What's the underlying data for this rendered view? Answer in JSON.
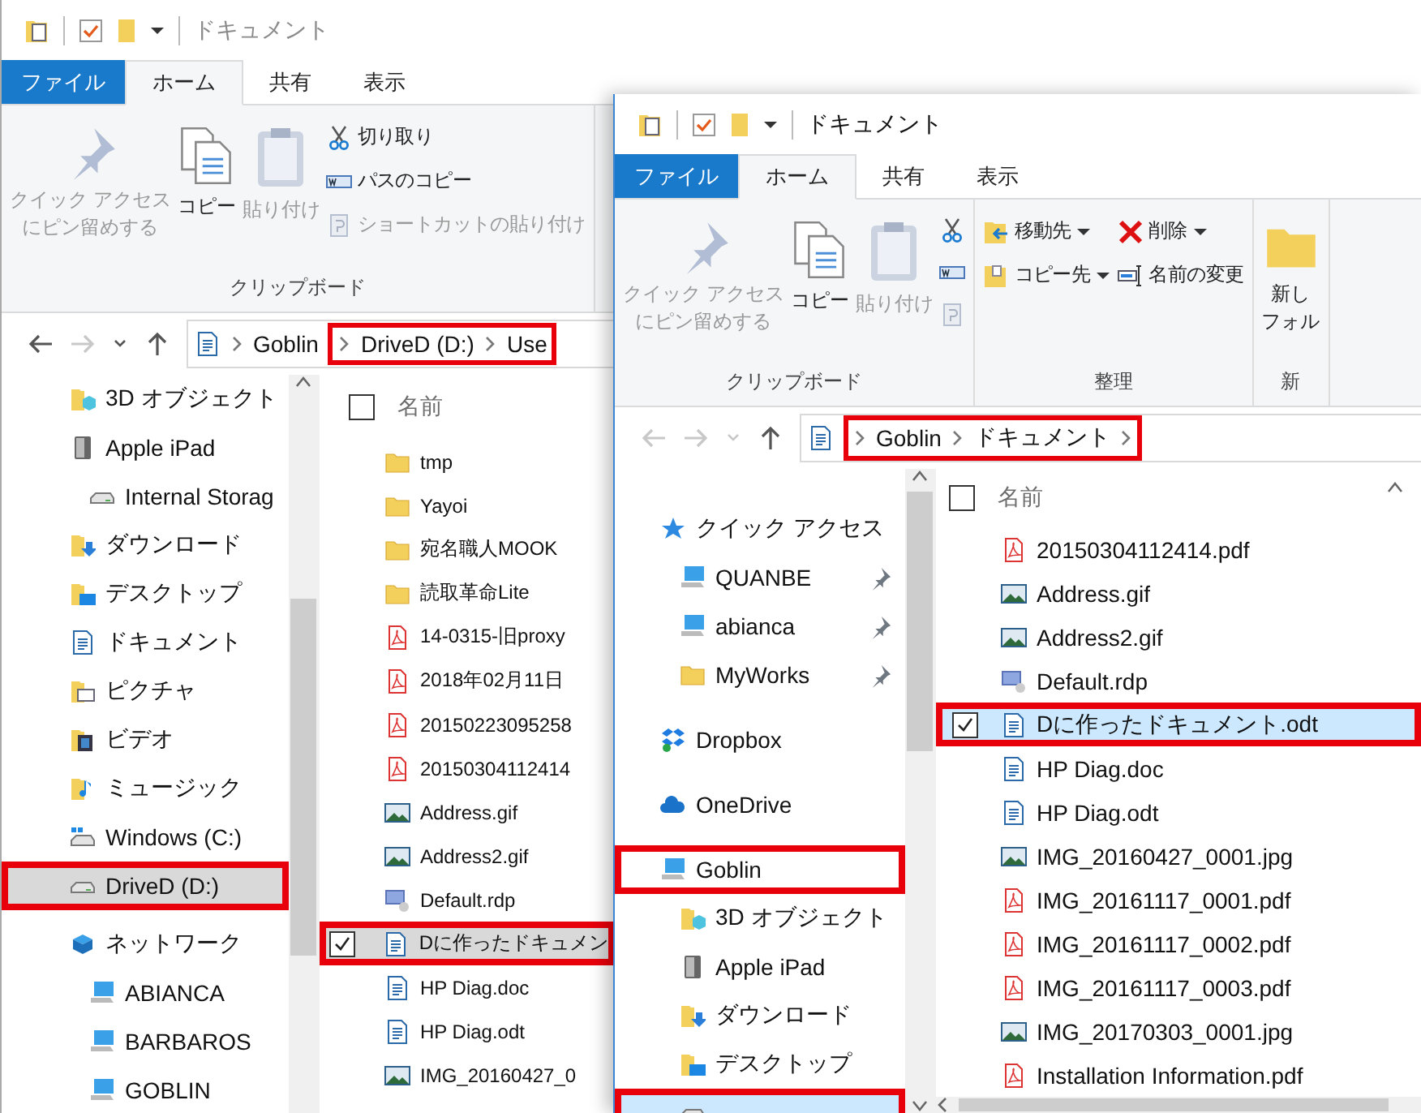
{
  "windows": [
    {
      "title": "ドキュメント",
      "active": false,
      "tabs": [
        {
          "label": "ファイル",
          "kind": "file",
          "selected": false
        },
        {
          "label": "ホーム",
          "kind": "tab",
          "selected": true
        },
        {
          "label": "共有",
          "kind": "tab",
          "selected": false
        },
        {
          "label": "表示",
          "kind": "tab",
          "selected": false
        }
      ],
      "ribbon_groups": [
        {
          "label": "クリップボード",
          "columns": [
            [
              {
                "kind": "pin",
                "lines": [
                  "クイック アクセス",
                  "にピン留めする"
                ],
                "disabled": true
              }
            ],
            [
              {
                "kind": "copy",
                "label": "コピー",
                "disabled": false
              }
            ],
            [
              {
                "kind": "paste",
                "label": "貼り付け",
                "disabled": true
              }
            ],
            [
              {
                "kind": "cut",
                "label": "切り取り",
                "disabled": false
              },
              {
                "kind": "copy_path",
                "label": "パスのコピー",
                "disabled": false
              },
              {
                "kind": "paste_shortcut",
                "label": "ショートカットの貼り付け",
                "disabled": true
              }
            ]
          ]
        }
      ],
      "address": {
        "crumbs": [
          {
            "label": "Goblin",
            "highlighted": false
          },
          {
            "label": "DriveD (D:)",
            "highlighted": true
          },
          {
            "label": "Use",
            "highlighted": true
          }
        ]
      },
      "nav_groups": [
        [
          {
            "label": "3D オブジェクト",
            "kind": "objects3d",
            "selected": false,
            "highlighted": false
          },
          {
            "label": "Apple iPad",
            "kind": "device",
            "selected": false,
            "highlighted": false,
            "children": [
              {
                "label": "Internal Storag",
                "kind": "drive",
                "selected": false,
                "highlighted": false
              }
            ]
          },
          {
            "label": "ダウンロード",
            "kind": "download",
            "selected": false,
            "highlighted": false
          },
          {
            "label": "デスクトップ",
            "kind": "desktop",
            "selected": false,
            "highlighted": false
          },
          {
            "label": "ドキュメント",
            "kind": "documents",
            "selected": false,
            "highlighted": false
          },
          {
            "label": "ピクチャ",
            "kind": "pictures",
            "selected": false,
            "highlighted": false
          },
          {
            "label": "ビデオ",
            "kind": "video",
            "selected": false,
            "highlighted": false
          },
          {
            "label": "ミュージック",
            "kind": "music",
            "selected": false,
            "highlighted": false
          },
          {
            "label": "Windows (C:)",
            "kind": "windrive",
            "selected": false,
            "highlighted": false
          },
          {
            "label": "DriveD (D:)",
            "kind": "drive",
            "selected": true,
            "highlighted": true
          }
        ],
        [
          {
            "label": "ネットワーク",
            "kind": "network",
            "selected": false,
            "highlighted": false,
            "children": [
              {
                "label": "ABIANCA",
                "kind": "computer",
                "selected": false,
                "highlighted": false
              },
              {
                "label": "BARBAROS",
                "kind": "computer",
                "selected": false,
                "highlighted": false
              },
              {
                "label": "GOBLIN",
                "kind": "computer",
                "selected": false,
                "highlighted": false
              }
            ]
          }
        ]
      ],
      "files": {
        "header": "名前",
        "rows": [
          {
            "name": "tmp",
            "kind": "folder",
            "selected": false,
            "highlighted": false
          },
          {
            "name": "Yayoi",
            "kind": "folder",
            "selected": false,
            "highlighted": false
          },
          {
            "name": "宛名職人MOOK",
            "kind": "folder",
            "selected": false,
            "highlighted": false
          },
          {
            "name": "読取革命Lite",
            "kind": "folder",
            "selected": false,
            "highlighted": false
          },
          {
            "name": "14-0315-旧proxy",
            "kind": "pdf",
            "selected": false,
            "highlighted": false
          },
          {
            "name": "2018年02月11日",
            "kind": "pdf",
            "selected": false,
            "highlighted": false
          },
          {
            "name": "20150223095258",
            "kind": "pdf",
            "selected": false,
            "highlighted": false
          },
          {
            "name": "20150304112414",
            "kind": "pdf",
            "selected": false,
            "highlighted": false
          },
          {
            "name": "Address.gif",
            "kind": "image",
            "selected": false,
            "highlighted": false
          },
          {
            "name": "Address2.gif",
            "kind": "image",
            "selected": false,
            "highlighted": false
          },
          {
            "name": "Default.rdp",
            "kind": "rdp",
            "selected": false,
            "highlighted": false
          },
          {
            "name": "Dに作ったドキュメン",
            "kind": "doc",
            "selected": true,
            "highlighted": true
          },
          {
            "name": "HP Diag.doc",
            "kind": "doc",
            "selected": false,
            "highlighted": false
          },
          {
            "name": "HP Diag.odt",
            "kind": "doc",
            "selected": false,
            "highlighted": false
          },
          {
            "name": "IMG_20160427_0",
            "kind": "image",
            "selected": false,
            "highlighted": false
          }
        ]
      }
    },
    {
      "title": "ドキュメント",
      "active": true,
      "tabs": [
        {
          "label": "ファイル",
          "kind": "file",
          "selected": false
        },
        {
          "label": "ホーム",
          "kind": "tab",
          "selected": true
        },
        {
          "label": "共有",
          "kind": "tab",
          "selected": false
        },
        {
          "label": "表示",
          "kind": "tab",
          "selected": false
        }
      ],
      "ribbon_groups": [
        {
          "label": "クリップボード",
          "columns": [
            [
              {
                "kind": "pin",
                "lines": [
                  "クイック アクセス",
                  "にピン留めする"
                ],
                "disabled": true
              }
            ],
            [
              {
                "kind": "copy",
                "label": "コピー",
                "disabled": false
              }
            ],
            [
              {
                "kind": "paste",
                "label": "貼り付け",
                "disabled": true
              }
            ],
            [
              {
                "kind": "cut",
                "disabled": false
              },
              {
                "kind": "copy_path",
                "disabled": false
              },
              {
                "kind": "paste_shortcut",
                "disabled": true
              }
            ]
          ]
        },
        {
          "label": "整理",
          "columns": [
            [
              {
                "kind": "move_to",
                "label": "移動先",
                "disabled": false,
                "dropdown": true
              },
              {
                "kind": "copy_to",
                "label": "コピー先",
                "disabled": false,
                "dropdown": true
              }
            ],
            [
              {
                "kind": "delete",
                "label": "削除",
                "disabled": false,
                "dropdown": true
              },
              {
                "kind": "rename",
                "label": "名前の変更",
                "disabled": false,
                "dropdown": false
              }
            ]
          ]
        },
        {
          "label": "新",
          "columns": [
            [
              {
                "kind": "new_folder",
                "lines": [
                  "新し",
                  "フォル"
                ],
                "disabled": false
              }
            ]
          ]
        }
      ],
      "address": {
        "crumbs": [
          {
            "label": "Goblin",
            "highlighted": true
          },
          {
            "label": "ドキュメント",
            "highlighted": true
          }
        ]
      },
      "nav_groups": [
        [
          {
            "label": "クイック アクセス",
            "kind": "star",
            "selected": false,
            "highlighted": false,
            "children": [
              {
                "label": "QUANBE",
                "kind": "computer",
                "selected": false,
                "highlighted": false,
                "pinned": true
              },
              {
                "label": "abianca",
                "kind": "computer",
                "selected": false,
                "highlighted": false,
                "pinned": true
              },
              {
                "label": "MyWorks",
                "kind": "folder",
                "selected": false,
                "highlighted": false,
                "pinned": true
              }
            ]
          }
        ],
        [
          {
            "label": "Dropbox",
            "kind": "dropbox",
            "selected": false,
            "highlighted": false
          }
        ],
        [
          {
            "label": "OneDrive",
            "kind": "cloud",
            "selected": false,
            "highlighted": false
          }
        ],
        [
          {
            "label": "Goblin",
            "kind": "computer",
            "selected": false,
            "highlighted": true,
            "children": [
              {
                "label": "3D オブジェクト",
                "kind": "objects3d",
                "selected": false,
                "highlighted": false
              },
              {
                "label": "Apple iPad",
                "kind": "device",
                "selected": false,
                "highlighted": false
              },
              {
                "label": "ダウンロード",
                "kind": "download",
                "selected": false,
                "highlighted": false
              },
              {
                "label": "デスクトップ",
                "kind": "desktop",
                "selected": false,
                "highlighted": false
              },
              {
                "kind": "drive",
                "selected": true,
                "highlighted": true
              }
            ]
          }
        ]
      ],
      "files": {
        "header": "名前",
        "rows": [
          {
            "name": "20150304112414.pdf",
            "kind": "pdf",
            "selected": false,
            "highlighted": false
          },
          {
            "name": "Address.gif",
            "kind": "image",
            "selected": false,
            "highlighted": false
          },
          {
            "name": "Address2.gif",
            "kind": "image",
            "selected": false,
            "highlighted": false
          },
          {
            "name": "Default.rdp",
            "kind": "rdp",
            "selected": false,
            "highlighted": false
          },
          {
            "name": "Dに作ったドキュメント.odt",
            "kind": "doc",
            "selected": true,
            "highlighted": true
          },
          {
            "name": "HP Diag.doc",
            "kind": "doc",
            "selected": false,
            "highlighted": false
          },
          {
            "name": "HP Diag.odt",
            "kind": "doc",
            "selected": false,
            "highlighted": false
          },
          {
            "name": "IMG_20160427_0001.jpg",
            "kind": "image",
            "selected": false,
            "highlighted": false
          },
          {
            "name": "IMG_20161117_0001.pdf",
            "kind": "pdf",
            "selected": false,
            "highlighted": false
          },
          {
            "name": "IMG_20161117_0002.pdf",
            "kind": "pdf",
            "selected": false,
            "highlighted": false
          },
          {
            "name": "IMG_20161117_0003.pdf",
            "kind": "pdf",
            "selected": false,
            "highlighted": false
          },
          {
            "name": "IMG_20170303_0001.jpg",
            "kind": "image",
            "selected": false,
            "highlighted": false
          },
          {
            "name": "Installation Information.pdf",
            "kind": "pdf",
            "selected": false,
            "highlighted": false
          }
        ]
      }
    }
  ]
}
